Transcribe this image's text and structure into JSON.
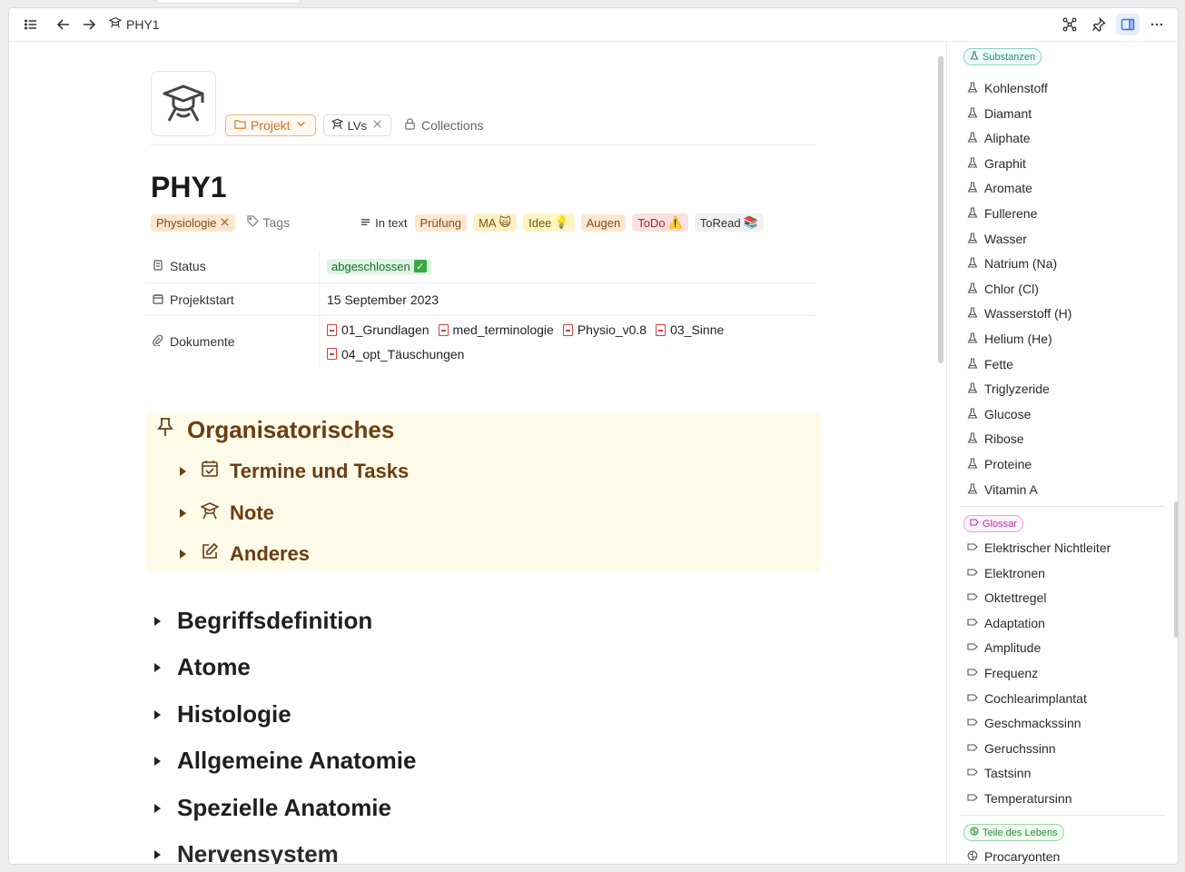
{
  "topbar": {
    "breadcrumb": "PHY1"
  },
  "page": {
    "title": "PHY1",
    "project_chip": "Projekt",
    "lvs_chip": "LVs",
    "collections": "Collections",
    "tags_placeholder": "Tags",
    "physiologie_tag": "Physiologie",
    "in_text_label": "In text",
    "inline_tags": [
      {
        "label": "Prüfung",
        "emoji": ""
      },
      {
        "label": "MA",
        "emoji": "🙀"
      },
      {
        "label": "Idee",
        "emoji": "💡"
      },
      {
        "label": "Augen",
        "emoji": ""
      },
      {
        "label": "ToDo",
        "emoji": "⚠️"
      },
      {
        "label": "ToRead",
        "emoji": "📚"
      }
    ],
    "properties": {
      "status_label": "Status",
      "status_value": "abgeschlossen",
      "start_label": "Projektstart",
      "start_value": "15 September 2023",
      "docs_label": "Dokumente",
      "docs": [
        "01_Grundlagen",
        "med_terminologie",
        "Physio_v0.8",
        "03_Sinne",
        "04_opt_Täuschungen"
      ]
    },
    "callout": {
      "title": "Organisatorisches",
      "items": [
        "Termine und Tasks",
        "Note",
        "Anderes"
      ]
    },
    "sections": [
      "Begriffsdefinition",
      "Atome",
      "Histologie",
      "Allgemeine Anatomie",
      "Spezielle Anatomie",
      "Nervensystem"
    ]
  },
  "sidebar": {
    "substanzen": {
      "label": "Substanzen",
      "items": [
        "Kohlenstoff",
        "Diamant",
        "Aliphate",
        "Graphit",
        "Aromate",
        "Fullerene",
        "Wasser",
        "Natrium (Na)",
        "Chlor (Cl)",
        "Wasserstoff (H)",
        "Helium (He)",
        "Fette",
        "Triglyzeride",
        "Glucose",
        "Ribose",
        "Proteine",
        "Vitamin A"
      ]
    },
    "glossar": {
      "label": "Glossar",
      "items": [
        "Elektrischer Nichtleiter",
        "Elektronen",
        "Oktettregel",
        "Adaptation",
        "Amplitude",
        "Frequenz",
        "Cochlearimplantat",
        "Geschmackssinn",
        "Geruchssinn",
        "Tastsinn",
        "Temperatursinn"
      ]
    },
    "teile": {
      "label": "Teile des Lebens",
      "items": [
        "Procaryonten"
      ]
    }
  }
}
